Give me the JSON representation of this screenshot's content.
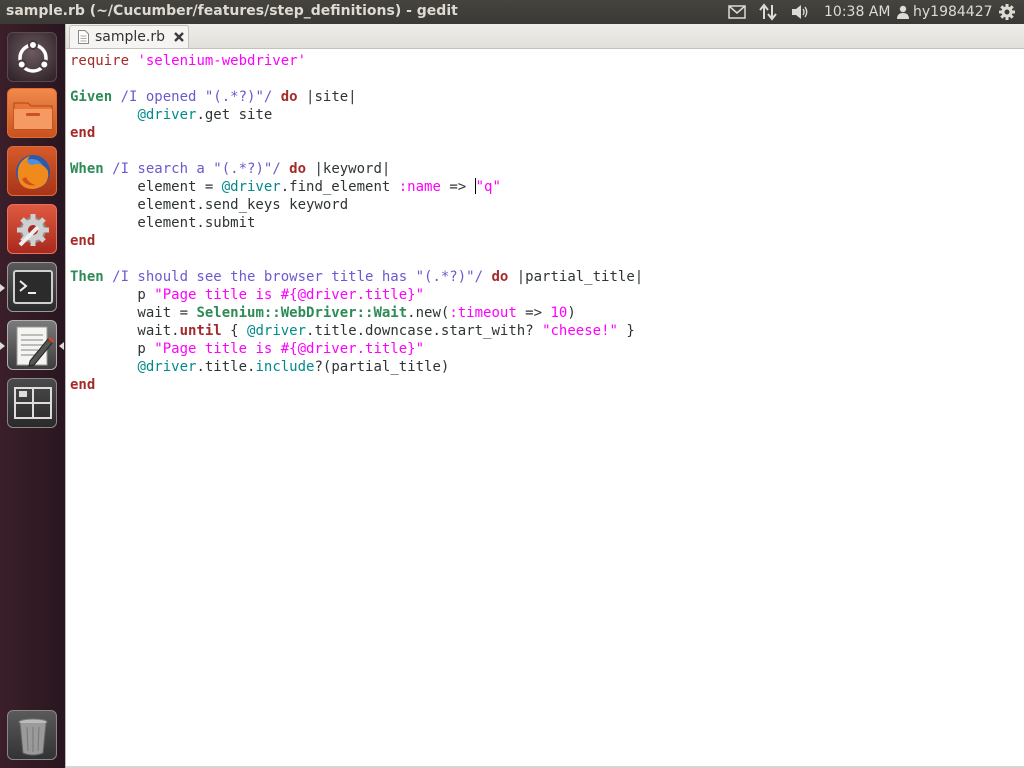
{
  "window": {
    "title": "sample.rb (~/Cucumber/features/step_definitions) - gedit"
  },
  "panel": {
    "clock": "10:38 AM",
    "user": "hy1984427",
    "indicators": [
      "mail-icon",
      "network-icon",
      "volume-icon",
      "gear-icon"
    ]
  },
  "launcher": {
    "items": [
      "dash-home",
      "files",
      "firefox",
      "system-settings",
      "terminal",
      "gedit",
      "workspace-switcher",
      "trash"
    ],
    "active": [
      "terminal",
      "gedit"
    ]
  },
  "editor": {
    "tab_label": "sample.rb",
    "lines": [
      [
        {
          "t": "require ",
          "c": "k2"
        },
        {
          "t": "'selenium-webdriver'",
          "c": "s"
        }
      ],
      [],
      [
        {
          "t": "Given",
          "c": "g"
        },
        {
          "t": " /I opened ",
          "c": "r"
        },
        {
          "t": "\"(.*?)\"",
          "c": "r"
        },
        {
          "t": "/ ",
          "c": "r"
        },
        {
          "t": "do",
          "c": "k"
        },
        {
          "t": " |site|",
          "c": "c"
        }
      ],
      [
        {
          "t": "        ",
          "c": "c"
        },
        {
          "t": "@driver",
          "c": "iv"
        },
        {
          "t": ".get site",
          "c": "c"
        }
      ],
      [
        {
          "t": "end",
          "c": "k"
        }
      ],
      [],
      [
        {
          "t": "When",
          "c": "g"
        },
        {
          "t": " /I search a ",
          "c": "r"
        },
        {
          "t": "\"(.*?)\"",
          "c": "r"
        },
        {
          "t": "/ ",
          "c": "r"
        },
        {
          "t": "do",
          "c": "k"
        },
        {
          "t": " |keyword|",
          "c": "c"
        }
      ],
      [
        {
          "t": "        element = ",
          "c": "c"
        },
        {
          "t": "@driver",
          "c": "iv"
        },
        {
          "t": ".find_element ",
          "c": "c"
        },
        {
          "t": ":name",
          "c": "s"
        },
        {
          "t": " => ",
          "c": "c"
        },
        {
          "t": "CURSOR",
          "c": "cursor"
        },
        {
          "t": "\"q\"",
          "c": "s"
        }
      ],
      [
        {
          "t": "        element.send_keys keyword",
          "c": "c"
        }
      ],
      [
        {
          "t": "        element.submit",
          "c": "c"
        }
      ],
      [
        {
          "t": "end",
          "c": "k"
        }
      ],
      [],
      [
        {
          "t": "Then",
          "c": "g"
        },
        {
          "t": " /I should see the browser title has ",
          "c": "r"
        },
        {
          "t": "\"(.*?)\"",
          "c": "r"
        },
        {
          "t": "/ ",
          "c": "r"
        },
        {
          "t": "do",
          "c": "k"
        },
        {
          "t": " |partial_title|",
          "c": "c"
        }
      ],
      [
        {
          "t": "        p ",
          "c": "c"
        },
        {
          "t": "\"Page title is #{@driver.title}\"",
          "c": "s"
        }
      ],
      [
        {
          "t": "        wait = ",
          "c": "c"
        },
        {
          "t": "Selenium::WebDriver::Wait",
          "c": "cls"
        },
        {
          "t": ".new(",
          "c": "c"
        },
        {
          "t": ":timeout",
          "c": "s"
        },
        {
          "t": " => ",
          "c": "c"
        },
        {
          "t": "10",
          "c": "s"
        },
        {
          "t": ")",
          "c": "c"
        }
      ],
      [
        {
          "t": "        wait.",
          "c": "c"
        },
        {
          "t": "until",
          "c": "k"
        },
        {
          "t": " { ",
          "c": "c"
        },
        {
          "t": "@driver",
          "c": "iv"
        },
        {
          "t": ".title.downcase.start_with? ",
          "c": "c"
        },
        {
          "t": "\"cheese!\"",
          "c": "s"
        },
        {
          "t": " }",
          "c": "c"
        }
      ],
      [
        {
          "t": "        p ",
          "c": "c"
        },
        {
          "t": "\"Page title is #{@driver.title}\"",
          "c": "s"
        }
      ],
      [
        {
          "t": "        ",
          "c": "c"
        },
        {
          "t": "@driver",
          "c": "iv"
        },
        {
          "t": ".title.",
          "c": "c"
        },
        {
          "t": "include",
          "c": "iv"
        },
        {
          "t": "?(partial_title)",
          "c": "c"
        }
      ],
      [
        {
          "t": "end",
          "c": "k"
        }
      ]
    ]
  },
  "colors": {
    "keyword": "#a52a2a",
    "step_keyword": "#2e8b57",
    "string": "#ff00ff",
    "regex": "#6a5acd",
    "ivar": "#008a8c"
  }
}
